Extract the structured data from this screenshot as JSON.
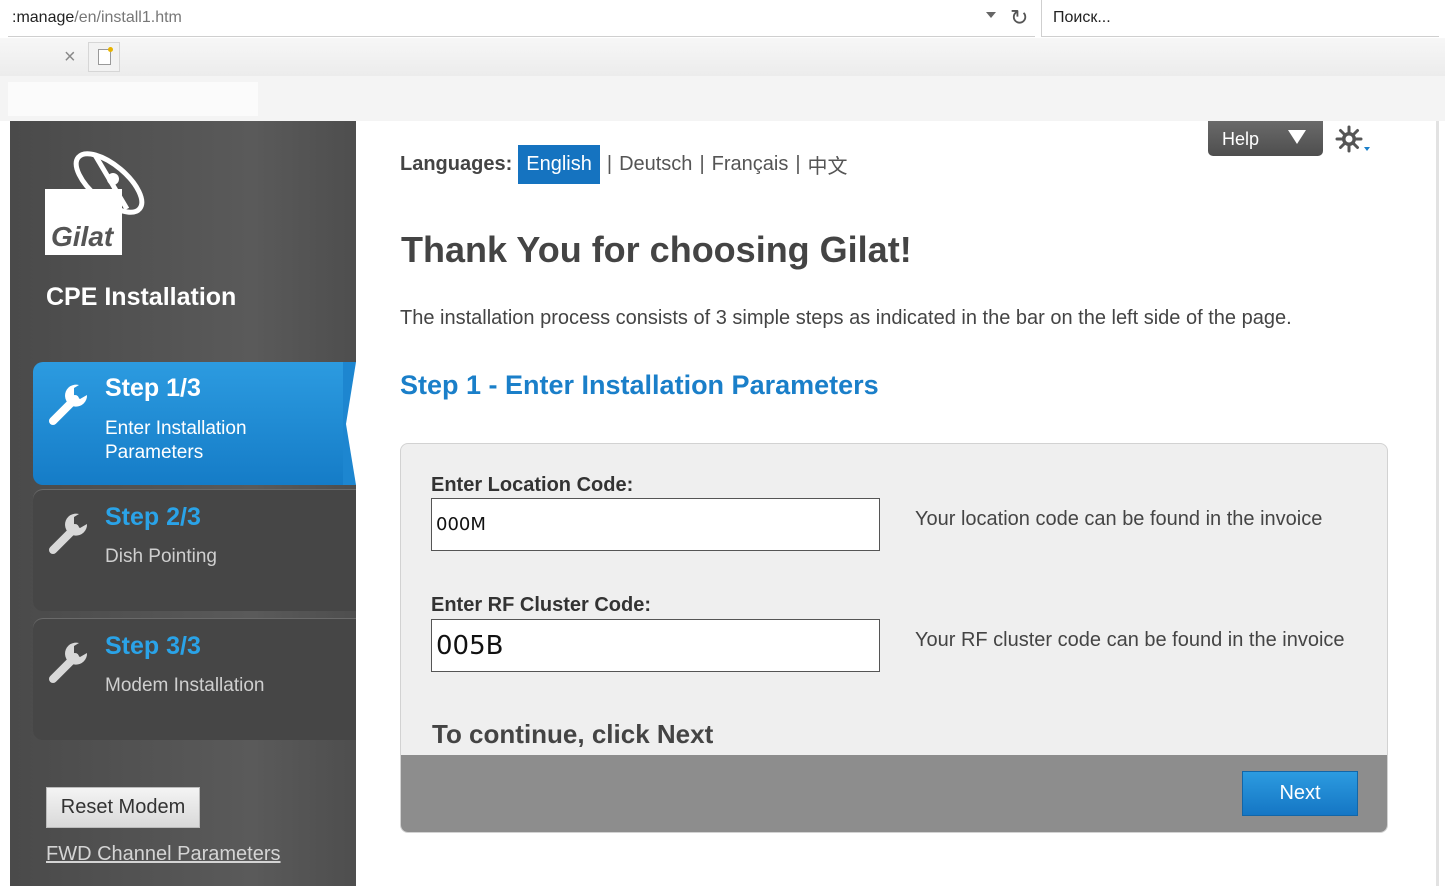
{
  "browser": {
    "url_prefix": ":manage",
    "url_path": "/en/install1.htm",
    "search_placeholder": "Поиск..."
  },
  "sidebar": {
    "logo_text": "Gilat",
    "title": "CPE Installation",
    "steps": [
      {
        "title": "Step 1/3",
        "desc_line1": "Enter Installation",
        "desc_line2": "Parameters"
      },
      {
        "title": "Step 2/3",
        "desc_line1": "Dish Pointing"
      },
      {
        "title": "Step 3/3",
        "desc_line1": "Modem Installation"
      }
    ],
    "reset_label": "Reset Modem",
    "fwd_link": "FWD Channel Parameters"
  },
  "header": {
    "languages_label": "Languages:",
    "languages": [
      "English",
      "Deutsch",
      "Français",
      "中文"
    ],
    "help_label": "Help"
  },
  "main": {
    "title": "Thank You for choosing Gilat!",
    "intro": "The installation process consists of 3 simple steps as indicated in the bar on the left side of the page.",
    "step_heading": "Step 1 - Enter Installation Parameters",
    "location_label": "Enter Location Code:",
    "location_value": "000M",
    "location_hint": "Your location code can be found in the invoice",
    "rf_label": "Enter RF Cluster Code:",
    "rf_value": "005B",
    "rf_hint": "Your RF cluster code can be found in the invoice",
    "continue_text": "To continue, click Next",
    "next_label": "Next"
  },
  "colors": {
    "accent_blue": "#1a7fc9",
    "sidebar_bg": "#555555",
    "active_step": "#2c9be0"
  },
  "icons": [
    "reload-icon",
    "close-icon",
    "new-tab-icon",
    "gilat-logo",
    "wrench-icon",
    "settings-gear-icon",
    "chevron-down-icon"
  ]
}
